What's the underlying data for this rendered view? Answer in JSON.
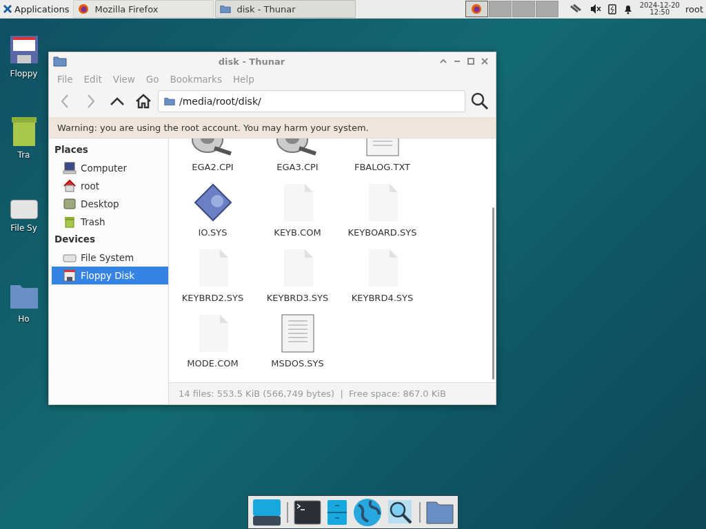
{
  "panel": {
    "applications": "Applications",
    "tasks": [
      {
        "title": "Mozilla Firefox",
        "kind": "firefox",
        "selected": false
      },
      {
        "title": "disk - Thunar",
        "kind": "folder",
        "selected": true
      }
    ],
    "workspaces": [
      {
        "selected": true
      },
      {
        "selected": false
      },
      {
        "selected": false
      },
      {
        "selected": false
      }
    ],
    "date": "2024-12-20",
    "time": "12:50",
    "user": "root"
  },
  "desktop_icons": [
    {
      "label": "Floppy",
      "kind": "floppy"
    },
    {
      "label": "Tra",
      "kind": "trash"
    },
    {
      "label": "File Sy",
      "kind": "drive"
    },
    {
      "label": "Ho",
      "kind": "home"
    }
  ],
  "window": {
    "title": "disk - Thunar",
    "menu": [
      "File",
      "Edit",
      "View",
      "Go",
      "Bookmarks",
      "Help"
    ],
    "location": "/media/root/disk/",
    "warning": "Warning: you are using the root account. You may harm your system.",
    "sidebar": [
      {
        "title": "Places",
        "items": [
          {
            "label": "Computer",
            "kind": "computer",
            "selected": false
          },
          {
            "label": "root",
            "kind": "home",
            "selected": false
          },
          {
            "label": "Desktop",
            "kind": "desktop",
            "selected": false
          },
          {
            "label": "Trash",
            "kind": "trash",
            "selected": false
          }
        ]
      },
      {
        "title": "Devices",
        "items": [
          {
            "label": "File System",
            "kind": "drive",
            "selected": false
          },
          {
            "label": "Floppy Disk",
            "kind": "floppy",
            "selected": true
          }
        ]
      }
    ],
    "files": [
      {
        "name": "EGA2.CPI",
        "kind": "media"
      },
      {
        "name": "EGA3.CPI",
        "kind": "media"
      },
      {
        "name": "FBALOG.TXT",
        "kind": "text"
      },
      {
        "name": "IO.SYS",
        "kind": "exec"
      },
      {
        "name": "KEYB.COM",
        "kind": "blank"
      },
      {
        "name": "KEYBOARD.SYS",
        "kind": "blank"
      },
      {
        "name": "KEYBRD2.SYS",
        "kind": "blank"
      },
      {
        "name": "KEYBRD3.SYS",
        "kind": "blank"
      },
      {
        "name": "KEYBRD4.SYS",
        "kind": "blank"
      },
      {
        "name": "MODE.COM",
        "kind": "blank"
      },
      {
        "name": "MSDOS.SYS",
        "kind": "text"
      }
    ],
    "status": "14 files: 553.5 KiB (566,749 bytes)  |  Free space: 867.0 KiB"
  }
}
